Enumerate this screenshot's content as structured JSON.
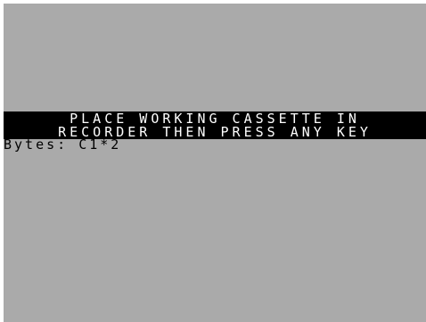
{
  "screen": {
    "background_color": "#aaaaaa",
    "band_color": "#000000",
    "band_text_color": "#ffffff",
    "status_text_color": "#000000"
  },
  "prompt": {
    "line1": "PLACE WORKING CASSETTE IN",
    "line2": "RECORDER THEN PRESS ANY KEY"
  },
  "status": {
    "text": "Bytes: C1*2"
  }
}
